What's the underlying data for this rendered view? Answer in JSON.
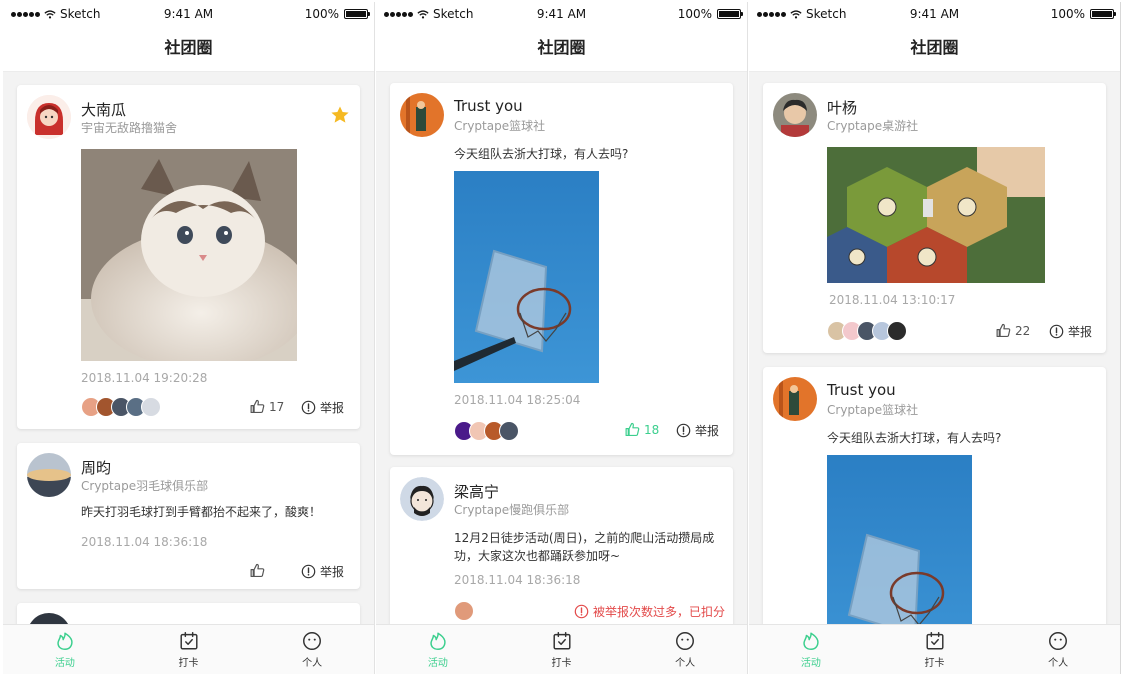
{
  "status_bar": {
    "carrier": "Sketch",
    "time": "9:41 AM",
    "battery": "100%"
  },
  "nav": {
    "title": "社团圈"
  },
  "tabs": [
    {
      "label": "活动",
      "icon": "flame-icon",
      "active": true
    },
    {
      "label": "打卡",
      "icon": "calendar-check-icon",
      "active": false
    },
    {
      "label": "个人",
      "icon": "smiley-face-icon",
      "active": false
    }
  ],
  "colors": {
    "accent": "#3ccf8e",
    "warning": "#e34a4a",
    "star": "#f5b922"
  },
  "screens": [
    {
      "posts": [
        {
          "name": "大南瓜",
          "club": "宇宙无敌路撸猫舍",
          "photo": "kitten-photo",
          "starred": true,
          "timestamp": "2018.11.04 19:20:28",
          "likes": "17",
          "report": "举报"
        },
        {
          "name": "周昀",
          "club": "Cryptape羽毛球俱乐部",
          "text": "昨天打羽毛球打到手臂都抬不起来了，酸爽！",
          "timestamp": "2018.11.04 18:36:18",
          "likes": "",
          "report": "举报"
        }
      ]
    },
    {
      "posts": [
        {
          "name": "Trust you",
          "club": "Cryptape篮球社",
          "text": "今天组队去浙大打球，有人去吗?",
          "photo": "basketball-hoop-photo",
          "timestamp": "2018.11.04 18:25:04",
          "likes": "18",
          "liked": true,
          "report": "举报"
        },
        {
          "name": "梁高宁",
          "club": "Cryptape慢跑俱乐部",
          "text": "12月2日徒步活动(周日)，之前的爬山活动攒局成功，大家这次也都踊跃参加呀~",
          "timestamp": "2018.11.04 18:36:18",
          "report_warning": "被举报次数过多，已扣分"
        }
      ]
    },
    {
      "posts": [
        {
          "name": "叶杨",
          "club": "Cryptape桌游社",
          "photo": "board-game-photo",
          "timestamp": "2018.11.04 13:10:17",
          "likes": "22",
          "report": "举报"
        },
        {
          "name": "Trust you",
          "club": "Cryptape篮球社",
          "text": "今天组队去浙大打球，有人去吗?",
          "photo": "basketball-hoop-photo"
        }
      ]
    }
  ]
}
